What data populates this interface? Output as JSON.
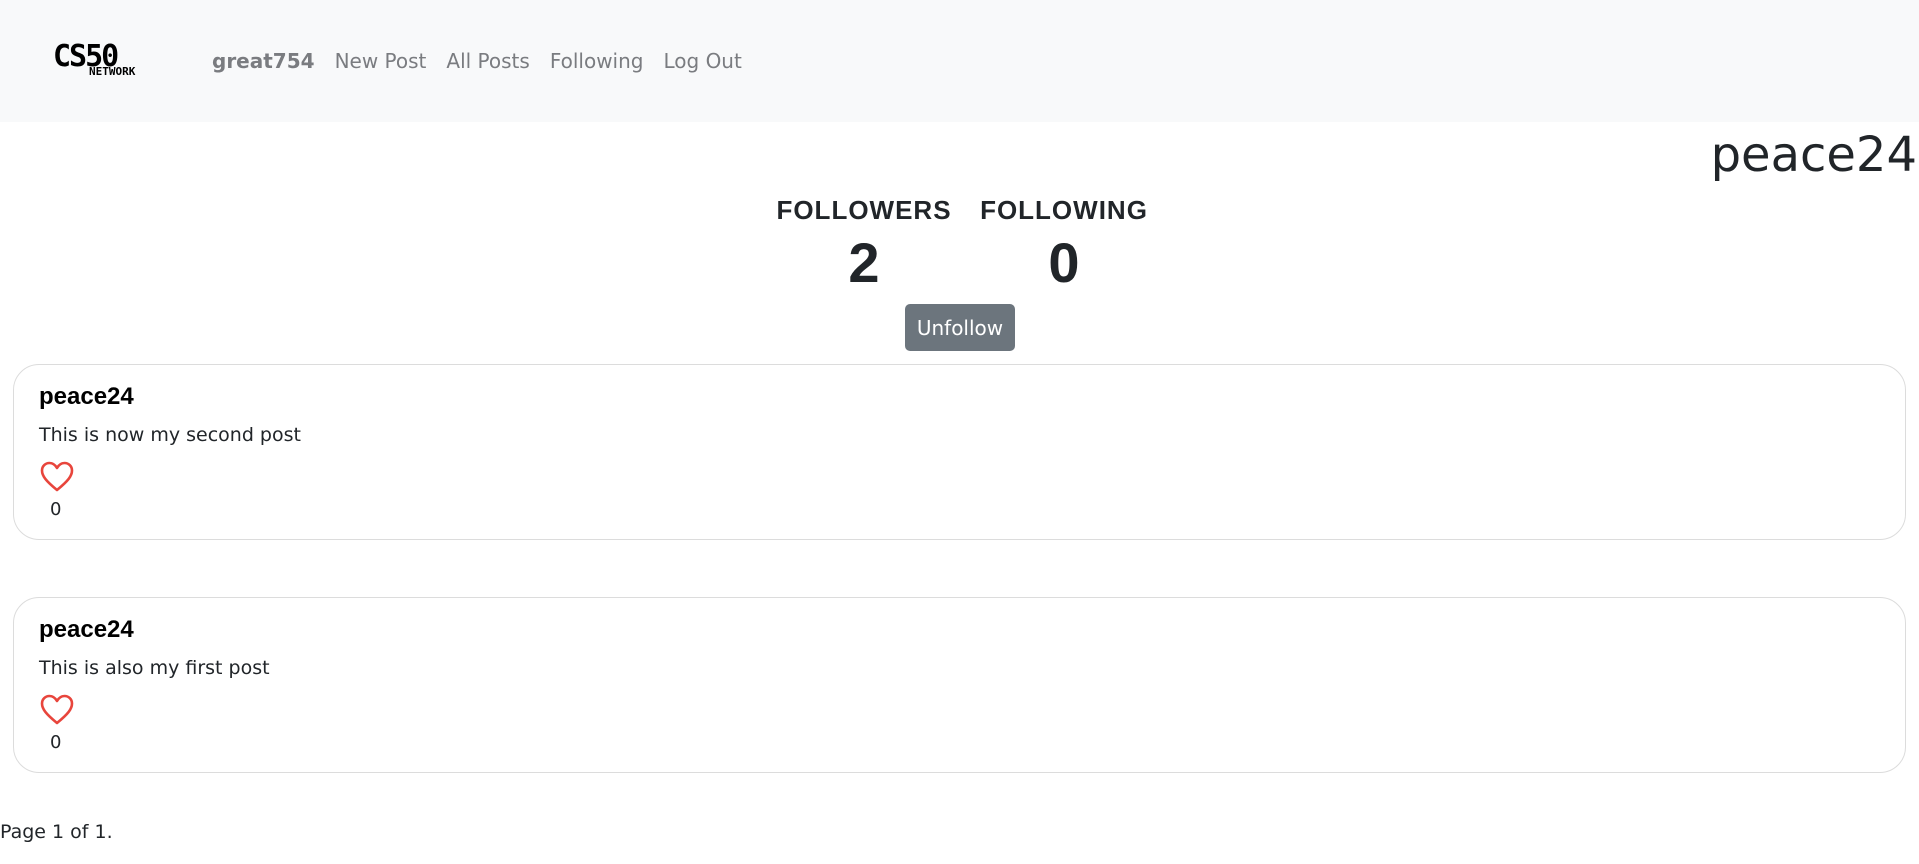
{
  "nav": {
    "logo_text": "CS50",
    "logo_subtext": "NETWORK",
    "links": [
      {
        "label": "great754"
      },
      {
        "label": "New Post"
      },
      {
        "label": "All Posts"
      },
      {
        "label": "Following"
      },
      {
        "label": "Log Out"
      }
    ]
  },
  "profile": {
    "username": "peace24",
    "followers_label": "FOLLOWERS",
    "followers_count": "2",
    "following_label": "FOLLOWING",
    "following_count": "0",
    "action_label": "Unfollow"
  },
  "posts": [
    {
      "author": "peace24",
      "content": "This is now my second post",
      "likes": "0"
    },
    {
      "author": "peace24",
      "content": "This is also my first post",
      "likes": "0"
    }
  ],
  "pagination": {
    "text": "Page 1 of 1."
  },
  "colors": {
    "navbar_bg": "#f8f9fa",
    "button_bg": "#6c757d",
    "heart": "#e8453c"
  },
  "icons": {
    "like": "heart-outline-icon"
  }
}
